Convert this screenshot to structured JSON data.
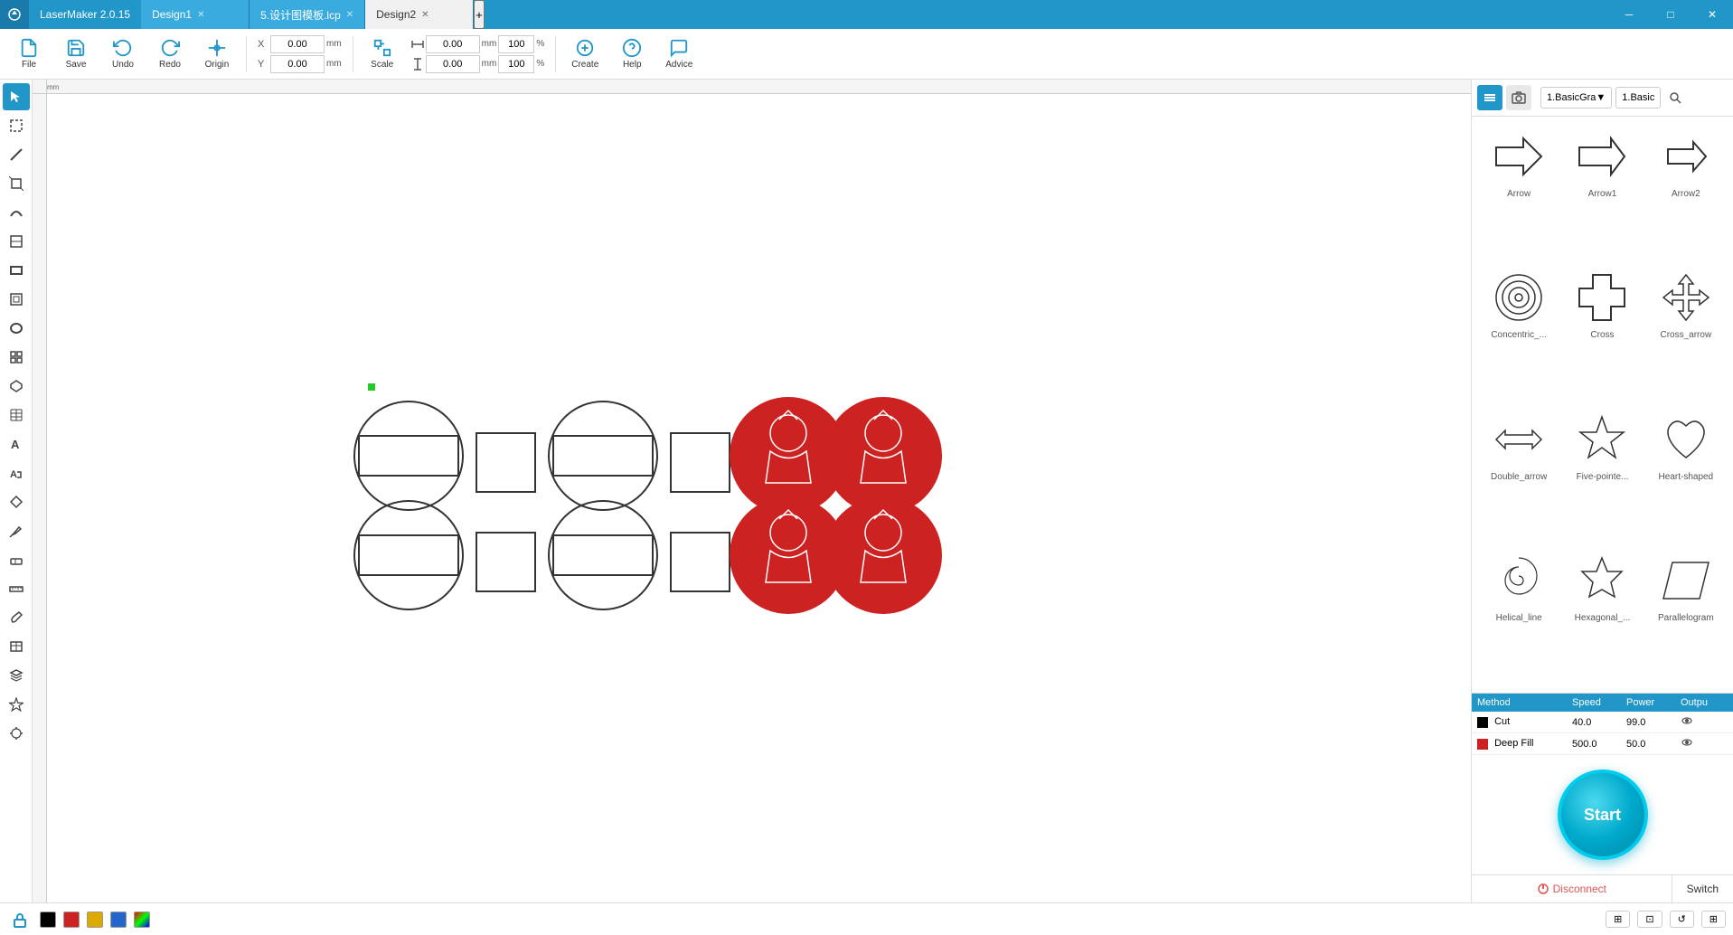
{
  "titlebar": {
    "app_name": "LaserMaker 2.0.15",
    "tabs": [
      {
        "label": "Design1",
        "active": false,
        "closable": true
      },
      {
        "label": "5.设计图模板.lcp",
        "active": false,
        "closable": true
      },
      {
        "label": "Design2",
        "active": true,
        "closable": true
      }
    ],
    "win_min": "─",
    "win_max": "□",
    "win_close": "✕"
  },
  "toolbar": {
    "file_label": "File",
    "save_label": "Save",
    "undo_label": "Undo",
    "redo_label": "Redo",
    "origin_label": "Origin",
    "x_label": "X",
    "y_label": "Y",
    "x_value": "0.00",
    "y_value": "0.00",
    "mm_label": "mm",
    "scale_label": "Scale",
    "w_value": "0.00",
    "h_value": "0.00",
    "pct_w": "100",
    "pct_h": "100",
    "create_label": "Create",
    "help_label": "Help",
    "advice_label": "Advice"
  },
  "tools": [
    "arrow",
    "selection",
    "line",
    "crop",
    "curve",
    "crop2",
    "rectangle",
    "crop3",
    "ellipse",
    "grid",
    "hexagon",
    "grid2",
    "text",
    "text-shape",
    "diamond",
    "pen",
    "eraser",
    "ruler",
    "paint",
    "table",
    "layers",
    "shape-tool",
    "lock",
    "burst"
  ],
  "shapes": [
    {
      "name": "Arrow",
      "shape": "arrow"
    },
    {
      "name": "Arrow1",
      "shape": "arrow1"
    },
    {
      "name": "Arrow2",
      "shape": "arrow2"
    },
    {
      "name": "Concentric_...",
      "shape": "concentric"
    },
    {
      "name": "Cross",
      "shape": "cross"
    },
    {
      "name": "Cross_arrow",
      "shape": "cross_arrow"
    },
    {
      "name": "Double_arrow",
      "shape": "double_arrow"
    },
    {
      "name": "Five-pointe...",
      "shape": "five_point_star"
    },
    {
      "name": "Heart-shaped",
      "shape": "heart"
    },
    {
      "name": "Helical_line",
      "shape": "helical"
    },
    {
      "name": "Hexagonal_...",
      "shape": "hexagonal_star"
    },
    {
      "name": "Parallelogram",
      "shape": "parallelogram"
    }
  ],
  "right_panel": {
    "dropdown1": "1.BasicGra▼",
    "dropdown2": "1.Basic"
  },
  "layers": {
    "headers": [
      "Method",
      "Speed",
      "Power",
      "Outpu"
    ],
    "rows": [
      {
        "color": "#000000",
        "method": "Cut",
        "speed": "40.0",
        "power": "99.0",
        "visible": true
      },
      {
        "color": "#cc2222",
        "method": "Deep Fill",
        "speed": "500.0",
        "power": "50.0",
        "visible": true
      }
    ]
  },
  "start_button": "Start",
  "disconnect_button": "Disconnect",
  "switch_button": "Switch",
  "status": {
    "colors": [
      "#000000",
      "#cc2222",
      "#ddaa00",
      "#2266cc",
      "gradient"
    ],
    "buttons": [
      "⊞",
      "⊡",
      "↺",
      "⊞"
    ]
  }
}
